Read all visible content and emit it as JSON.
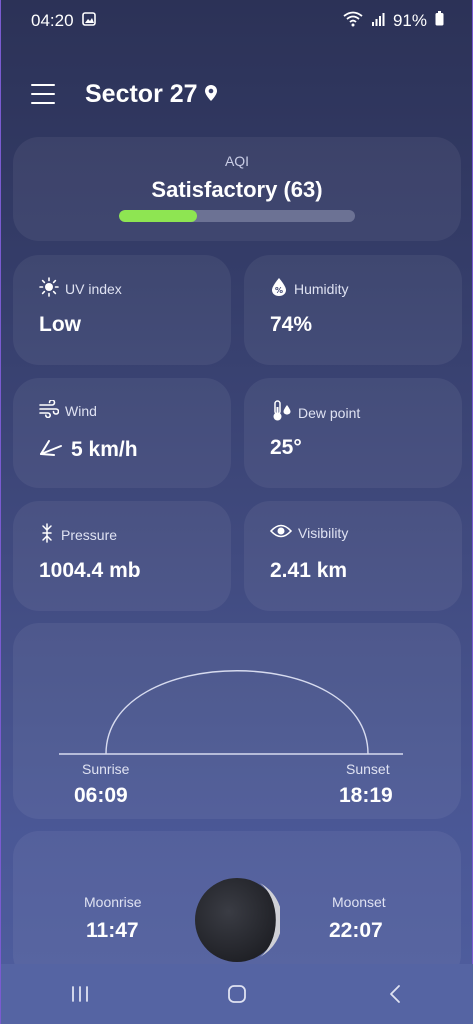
{
  "status_bar": {
    "time": "04:20",
    "battery": "91%"
  },
  "header": {
    "title": "Sector 27"
  },
  "aqi": {
    "label": "AQI",
    "value": "Satisfactory (63)",
    "progress": 0.33,
    "fill_color": "#8ee552"
  },
  "tiles": {
    "uv": {
      "label": "UV index",
      "value": "Low",
      "icon": "sun-icon"
    },
    "humidity": {
      "label": "Humidity",
      "value": "74%",
      "icon": "humidity-drop-icon"
    },
    "wind": {
      "label": "Wind",
      "value": "5 km/h",
      "icon": "wind-icon"
    },
    "dew": {
      "label": "Dew point",
      "value": "25°",
      "icon": "thermometer-drop-icon"
    },
    "pressure": {
      "label": "Pressure",
      "value": "1004.4 mb",
      "icon": "pressure-icon"
    },
    "visibility": {
      "label": "Visibility",
      "value": "2.41 km",
      "icon": "eye-icon"
    }
  },
  "sun": {
    "sunrise_label": "Sunrise",
    "sunrise_time": "06:09",
    "sunset_label": "Sunset",
    "sunset_time": "18:19"
  },
  "moon": {
    "moonrise_label": "Moonrise",
    "moonrise_time": "11:47",
    "moonset_label": "Moonset",
    "moonset_time": "22:07"
  }
}
